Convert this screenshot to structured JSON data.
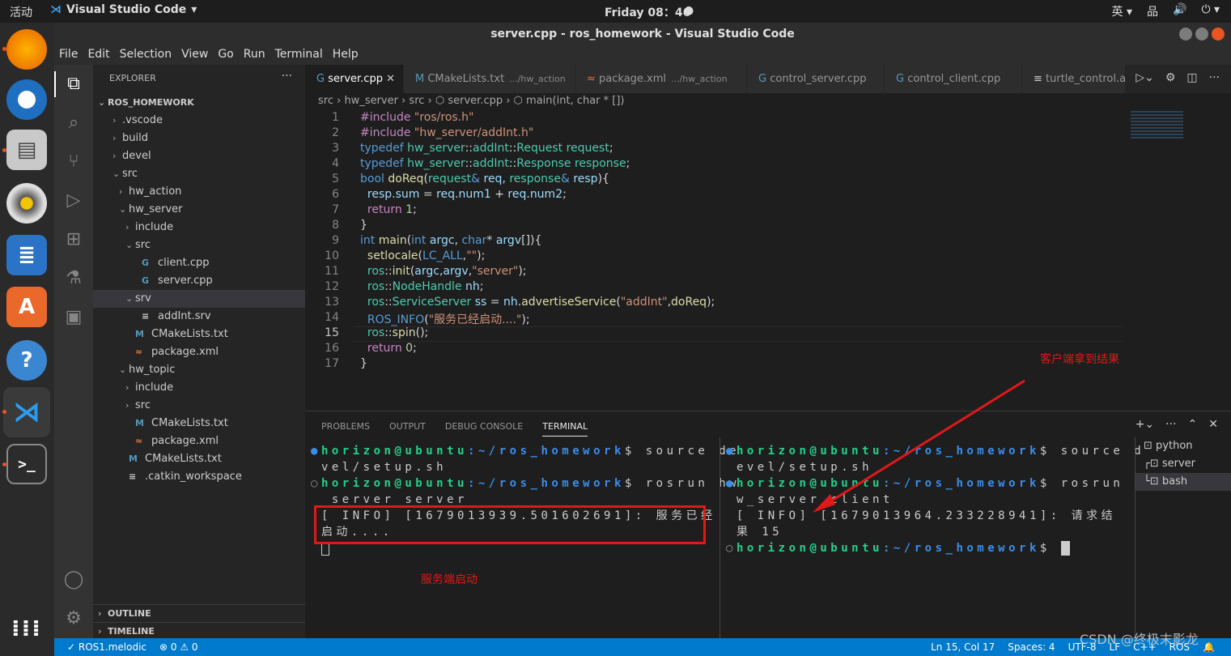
{
  "system": {
    "activities": "活动",
    "app_name": "Visual Studio Code",
    "clock": "Friday 08：46",
    "ime": "英"
  },
  "window": {
    "title": "server.cpp - ros_homework - Visual Studio Code"
  },
  "menu": [
    "File",
    "Edit",
    "Selection",
    "View",
    "Go",
    "Run",
    "Terminal",
    "Help"
  ],
  "explorer": {
    "header": "EXPLORER",
    "root": "ROS_HOMEWORK",
    "items": [
      {
        "label": ".vscode",
        "indent": 1,
        "type": "folder-closed"
      },
      {
        "label": "build",
        "indent": 1,
        "type": "folder-closed"
      },
      {
        "label": "devel",
        "indent": 1,
        "type": "folder-closed"
      },
      {
        "label": "src",
        "indent": 1,
        "type": "folder-open"
      },
      {
        "label": "hw_action",
        "indent": 2,
        "type": "folder-closed"
      },
      {
        "label": "hw_server",
        "indent": 2,
        "type": "folder-open"
      },
      {
        "label": "include",
        "indent": 3,
        "type": "folder-closed"
      },
      {
        "label": "src",
        "indent": 3,
        "type": "folder-open"
      },
      {
        "label": "client.cpp",
        "indent": 4,
        "type": "cpp"
      },
      {
        "label": "server.cpp",
        "indent": 4,
        "type": "cpp"
      },
      {
        "label": "srv",
        "indent": 3,
        "type": "folder-open",
        "selected": true
      },
      {
        "label": "addInt.srv",
        "indent": 4,
        "type": "srv"
      },
      {
        "label": "CMakeLists.txt",
        "indent": 3,
        "type": "cmake"
      },
      {
        "label": "package.xml",
        "indent": 3,
        "type": "xml"
      },
      {
        "label": "hw_topic",
        "indent": 2,
        "type": "folder-open"
      },
      {
        "label": "include",
        "indent": 3,
        "type": "folder-closed"
      },
      {
        "label": "src",
        "indent": 3,
        "type": "folder-closed"
      },
      {
        "label": "CMakeLists.txt",
        "indent": 3,
        "type": "cmake"
      },
      {
        "label": "package.xml",
        "indent": 3,
        "type": "xml"
      },
      {
        "label": "CMakeLists.txt",
        "indent": 2,
        "type": "cmake"
      },
      {
        "label": ".catkin_workspace",
        "indent": 2,
        "type": "srv"
      }
    ],
    "outline": "OUTLINE",
    "timeline": "TIMELINE"
  },
  "tabs": [
    {
      "label": "server.cpp",
      "desc": "",
      "icon": "G",
      "active": true
    },
    {
      "label": "CMakeLists.txt",
      "desc": ".../hw_action",
      "icon": "M"
    },
    {
      "label": "package.xml",
      "desc": ".../hw_action",
      "icon": "≈"
    },
    {
      "label": "control_server.cpp",
      "desc": "",
      "icon": "G"
    },
    {
      "label": "control_client.cpp",
      "desc": "",
      "icon": "G"
    },
    {
      "label": "turtle_control.a",
      "desc": "",
      "icon": "≡"
    }
  ],
  "breadcrumb": "src › hw_server › src › ⬡ server.cpp › ⬡ main(int, char * [])",
  "code_lines": [
    "1",
    "2",
    "3",
    "4",
    "5",
    "6",
    "7",
    "8",
    "9",
    "10",
    "11",
    "12",
    "13",
    "14",
    "15",
    "16",
    "17"
  ],
  "panel": {
    "tabs": [
      "PROBLEMS",
      "OUTPUT",
      "DEBUG CONSOLE",
      "TERMINAL"
    ],
    "left_term": {
      "prompt_user": "horizon@ubuntu",
      "prompt_path": ":~/ros_homework",
      "l1_cmd": "$ source de",
      "l1b": "vel/setup.sh",
      "l2_cmd": "$ rosrun hw",
      "l2b": "_server server",
      "l3": "[ INFO] [1679013939.501602691]: 服务已经",
      "l4": "启动...."
    },
    "right_term": {
      "l1_cmd": "$ source d",
      "l1b": "evel/setup.sh",
      "l2_cmd": "$ rosrun h",
      "l2b": "w_server client",
      "l3": "[ INFO] [1679013964.233228941]: 请求结",
      "l4": "果 15",
      "l5_cmd": "$ "
    },
    "term_list": [
      "python",
      "server",
      "bash"
    ]
  },
  "annotations": {
    "server_started": "服务端启动",
    "client_result": "客户端拿到结果"
  },
  "status": {
    "branch": "ROS1.melodic",
    "problems": "⊗ 0 ⚠ 0",
    "position": "Ln 15, Col 17",
    "spaces": "Spaces: 4",
    "encoding": "UTF-8",
    "eol": "LF",
    "lang": "C++",
    "ros": "ROS"
  },
  "watermark": "CSDN @终极末影龙"
}
